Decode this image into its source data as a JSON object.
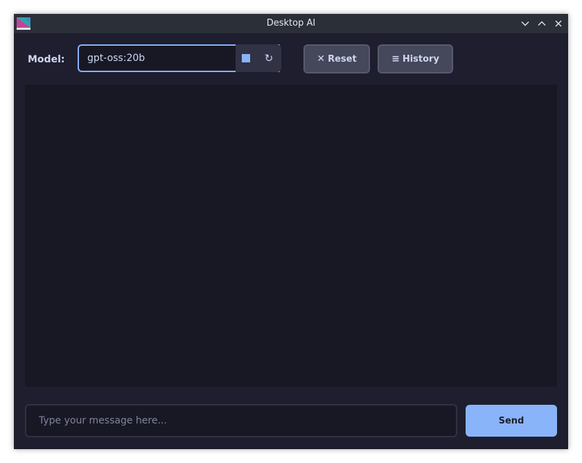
{
  "window": {
    "title": "Desktop AI"
  },
  "toolbar": {
    "model_label": "Model:",
    "model_value": "gpt-oss:20b",
    "stop_icon": "stop-square-icon",
    "refresh_icon": "↻",
    "reset_icon": "✕",
    "reset_label": "Reset",
    "history_icon": "≡",
    "history_label": "History"
  },
  "chat": {
    "messages": []
  },
  "composer": {
    "placeholder": "Type your message here...",
    "value": "",
    "send_label": "Send"
  },
  "colors": {
    "background": "#1e1e2e",
    "surface": "#181825",
    "accent": "#89b4fa",
    "button": "#45475a",
    "text": "#cdd6f4"
  }
}
